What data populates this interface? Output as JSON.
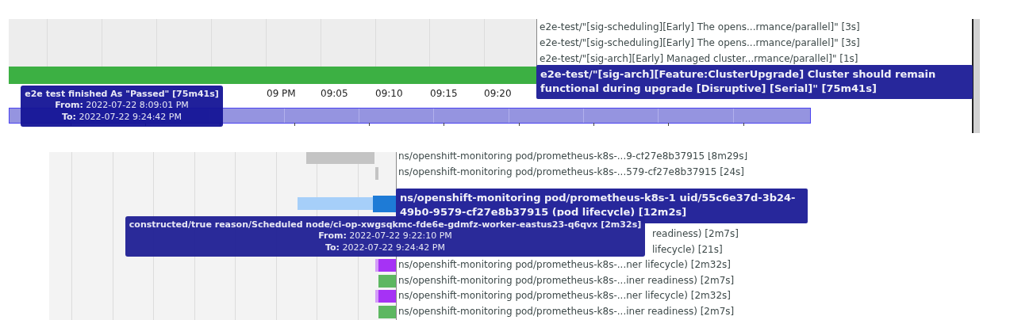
{
  "top_panel": {
    "rows": [
      {
        "label": "e2e-test/\"[sig-scheduling][Early] The opens...rmance/parallel]\" [3s]"
      },
      {
        "label": "e2e-test/\"[sig-scheduling][Early] The opens...rmance/parallel]\" [3s]"
      },
      {
        "label": "e2e-test/\"[sig-arch][Early] Managed cluster...rmance/parallel]\" [1s]"
      }
    ],
    "axis_ticks": [
      "09 PM",
      "09:05",
      "09:10",
      "09:15",
      "09:20"
    ],
    "hover_label": "e2e-test/\"[sig-arch][Feature:ClusterUpgrade] Cluster should remain functional during upgrade [Disruptive] [Serial]\" [75m41s]",
    "tooltip": {
      "title": "e2e test finished As \"Passed\" [75m41s]",
      "from_label": "From:",
      "from": "2022-07-22 8:09:01 PM",
      "to_label": "To:",
      "to": "2022-07-22 9:24:42 PM"
    }
  },
  "bottom_panel": {
    "rows": [
      {
        "kind": "full",
        "label": "ns/openshift-monitoring pod/prometheus-k8s-...9-cf27e8b37915 [8m29s]",
        "bars": [
          {
            "color": "#c4c4c4"
          }
        ]
      },
      {
        "kind": "full",
        "label": "ns/openshift-monitoring pod/prometheus-k8s-...579-cf27e8b37915 [24s]",
        "bars": [
          {
            "color": "#c4c4c4"
          }
        ]
      },
      {
        "kind": "covered",
        "bars": []
      },
      {
        "kind": "covered",
        "bars": [
          {
            "color": "#a6cff9"
          },
          {
            "color": "#1e7bd6"
          }
        ]
      },
      {
        "kind": "covered",
        "bars": []
      },
      {
        "kind": "tail",
        "label": "readiness) [2m7s]",
        "bars": []
      },
      {
        "kind": "tail",
        "label": "lifecycle) [21s]",
        "bars": []
      },
      {
        "kind": "full",
        "label": "ns/openshift-monitoring pod/prometheus-k8s-...ner lifecycle) [2m32s]",
        "bars": [
          {
            "color": "#d49cf9"
          },
          {
            "color": "#a632f5"
          }
        ]
      },
      {
        "kind": "full",
        "label": "ns/openshift-monitoring pod/prometheus-k8s-...iner readiness) [2m7s]",
        "bars": [
          {
            "color": "#5db761"
          }
        ]
      },
      {
        "kind": "full",
        "label": "ns/openshift-monitoring pod/prometheus-k8s-...ner lifecycle) [2m32s]",
        "bars": [
          {
            "color": "#d49cf9"
          },
          {
            "color": "#a632f5"
          }
        ]
      },
      {
        "kind": "full",
        "label": "ns/openshift-monitoring pod/prometheus-k8s-...iner readiness) [2m7s]",
        "bars": [
          {
            "color": "#5db761"
          }
        ]
      }
    ],
    "hover_label": "ns/openshift-monitoring pod/prometheus-k8s-1 uid/55c6e37d-3b24-49b0-9579-cf27e8b37915 (pod lifecycle) [12m2s]",
    "tooltip": {
      "title": "constructed/true reason/Scheduled node/ci-op-xwgsqkmc-fde6e-gdmfz-worker-eastus23-q6qvx [2m32s]",
      "from_label": "From:",
      "from": "2022-07-22 9:22:10 PM",
      "to_label": "To:",
      "to": "2022-07-22 9:24:42 PM"
    }
  }
}
